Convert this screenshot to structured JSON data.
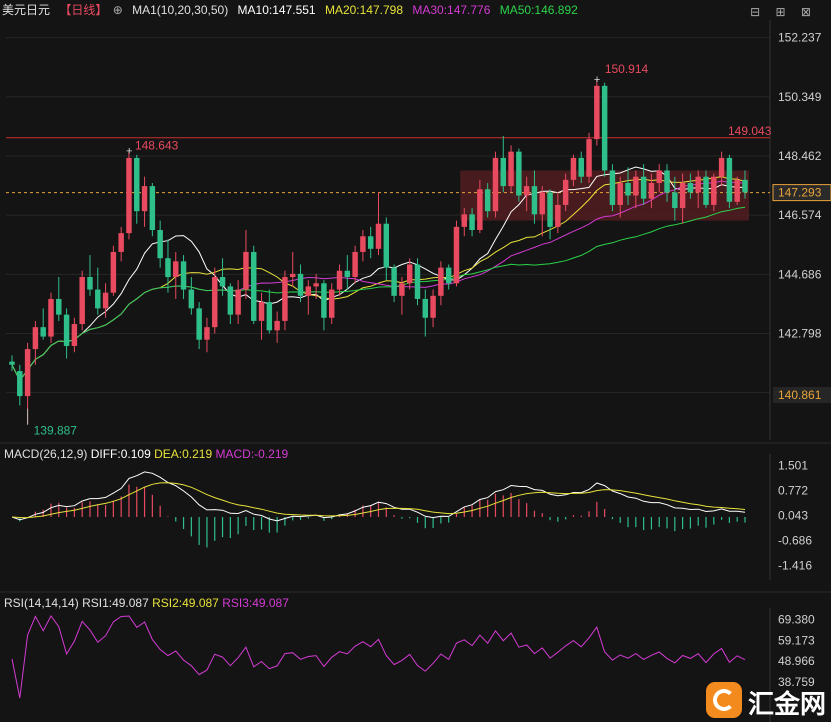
{
  "header": {
    "symbol": "美元日元",
    "period": "【日线】",
    "ma_title": "MA1(10,20,30,50)",
    "ma10": "MA10:147.551",
    "ma20": "MA20:147.798",
    "ma30": "MA30:147.776",
    "ma50": "MA50:146.892",
    "icons": "⊟ ⊞ ⊠"
  },
  "macd_header": {
    "title": "MACD(26,12,9)",
    "diff": "DIFF:0.109",
    "dea": "DEA:0.219",
    "macd": "MACD:-0.219"
  },
  "rsi_header": {
    "title": "RSI(14,14,14)",
    "rsi1": "RSI1:49.087",
    "rsi2": "RSI2:49.087",
    "rsi3": "RSI3:49.087"
  },
  "colors": {
    "up": "#e84a5f",
    "down": "#2fbf8a",
    "ma10": "#ffffff",
    "ma20": "#e8e23a",
    "ma30": "#d43bd4",
    "ma50": "#2bd44a",
    "bg": "#141414"
  },
  "chart_data": [
    {
      "type": "candlestick",
      "axis_ticks": [
        "152.237",
        "150.349",
        "148.462",
        "146.574",
        "144.686",
        "142.798",
        "140.910"
      ],
      "ylim": [
        139.4,
        152.8
      ],
      "annotations": {
        "high_label": "150.914",
        "high_value": 150.914,
        "mid_high_label": "148.643",
        "mid_high_value": 148.643,
        "low_label": "139.887",
        "low_value": 139.887,
        "resistance_label": "149.043",
        "resistance_value": 149.043,
        "current_label": "147.293",
        "current_value": 147.293,
        "min_label": "140.861"
      },
      "candles": [
        [
          141.9,
          142.1,
          141.6,
          141.8
        ],
        [
          141.6,
          141.8,
          140.5,
          140.8
        ],
        [
          140.8,
          142.5,
          139.9,
          142.3
        ],
        [
          142.3,
          143.2,
          141.8,
          143.0
        ],
        [
          143.0,
          143.6,
          142.6,
          142.7
        ],
        [
          142.7,
          144.1,
          142.5,
          143.9
        ],
        [
          143.9,
          144.6,
          143.2,
          143.4
        ],
        [
          143.4,
          143.6,
          142.0,
          142.4
        ],
        [
          142.4,
          143.3,
          142.2,
          143.1
        ],
        [
          143.1,
          144.8,
          142.9,
          144.6
        ],
        [
          144.6,
          145.3,
          144.0,
          144.2
        ],
        [
          144.2,
          144.9,
          143.4,
          143.6
        ],
        [
          143.6,
          144.4,
          143.3,
          144.1
        ],
        [
          144.1,
          145.6,
          144.0,
          145.4
        ],
        [
          145.4,
          146.2,
          145.1,
          146.0
        ],
        [
          146.0,
          148.6,
          145.8,
          148.4
        ],
        [
          148.4,
          148.5,
          146.3,
          146.7
        ],
        [
          146.7,
          147.8,
          146.2,
          147.5
        ],
        [
          147.5,
          147.6,
          145.9,
          146.1
        ],
        [
          146.1,
          146.4,
          144.9,
          145.2
        ],
        [
          145.2,
          145.8,
          144.1,
          144.6
        ],
        [
          144.6,
          145.4,
          143.9,
          145.1
        ],
        [
          145.1,
          145.3,
          143.9,
          144.2
        ],
        [
          144.2,
          144.6,
          143.4,
          143.6
        ],
        [
          143.6,
          143.8,
          142.3,
          142.6
        ],
        [
          142.6,
          143.3,
          142.2,
          143.0
        ],
        [
          143.0,
          144.9,
          142.8,
          144.6
        ],
        [
          144.6,
          145.2,
          144.0,
          144.3
        ],
        [
          144.3,
          144.4,
          143.1,
          143.4
        ],
        [
          143.4,
          144.5,
          143.1,
          144.2
        ],
        [
          144.2,
          146.1,
          143.9,
          145.4
        ],
        [
          145.4,
          145.6,
          143.1,
          143.2
        ],
        [
          143.2,
          144.1,
          142.6,
          143.8
        ],
        [
          143.8,
          144.2,
          142.8,
          142.9
        ],
        [
          142.9,
          143.5,
          142.5,
          143.2
        ],
        [
          143.2,
          144.8,
          142.9,
          144.6
        ],
        [
          144.6,
          145.4,
          144.3,
          144.7
        ],
        [
          144.7,
          145.0,
          143.8,
          144.0
        ],
        [
          144.0,
          144.5,
          143.4,
          144.3
        ],
        [
          144.3,
          144.7,
          143.9,
          144.4
        ],
        [
          144.4,
          144.5,
          142.9,
          143.3
        ],
        [
          143.3,
          144.4,
          143.1,
          144.2
        ],
        [
          144.2,
          145.0,
          144.0,
          144.8
        ],
        [
          144.8,
          145.3,
          144.2,
          144.6
        ],
        [
          144.6,
          145.6,
          144.4,
          145.4
        ],
        [
          145.4,
          146.1,
          145.1,
          145.9
        ],
        [
          145.9,
          146.2,
          145.2,
          145.5
        ],
        [
          145.5,
          147.3,
          145.3,
          146.3
        ],
        [
          146.3,
          146.5,
          144.5,
          144.9
        ],
        [
          144.9,
          145.0,
          143.8,
          144.0
        ],
        [
          144.0,
          144.6,
          143.4,
          144.4
        ],
        [
          144.4,
          145.2,
          144.2,
          145.0
        ],
        [
          145.0,
          145.2,
          143.7,
          143.9
        ],
        [
          143.9,
          144.2,
          142.7,
          143.3
        ],
        [
          143.3,
          144.2,
          143.0,
          144.0
        ],
        [
          144.0,
          145.1,
          143.7,
          144.9
        ],
        [
          144.9,
          145.0,
          144.2,
          144.4
        ],
        [
          144.4,
          146.4,
          144.3,
          146.2
        ],
        [
          146.2,
          146.8,
          145.9,
          146.6
        ],
        [
          146.6,
          146.8,
          145.9,
          146.1
        ],
        [
          146.1,
          147.7,
          146.0,
          147.4
        ],
        [
          147.4,
          147.6,
          146.5,
          146.7
        ],
        [
          146.7,
          148.6,
          146.5,
          148.4
        ],
        [
          148.4,
          149.1,
          147.3,
          147.5
        ],
        [
          147.5,
          148.8,
          147.3,
          148.6
        ],
        [
          148.6,
          148.7,
          147.0,
          147.2
        ],
        [
          147.2,
          147.8,
          146.7,
          147.5
        ],
        [
          147.5,
          148.0,
          146.3,
          146.6
        ],
        [
          146.6,
          147.5,
          145.9,
          147.3
        ],
        [
          147.3,
          147.4,
          145.8,
          146.2
        ],
        [
          146.2,
          147.3,
          146.0,
          146.9
        ],
        [
          146.9,
          147.9,
          146.7,
          147.7
        ],
        [
          147.7,
          148.5,
          147.5,
          148.4
        ],
        [
          148.4,
          148.6,
          147.6,
          147.8
        ],
        [
          147.8,
          149.2,
          147.6,
          149.0
        ],
        [
          149.0,
          150.9,
          148.8,
          150.7
        ],
        [
          150.7,
          150.8,
          147.8,
          148.0
        ],
        [
          148.0,
          148.2,
          146.7,
          146.9
        ],
        [
          146.9,
          147.8,
          146.5,
          147.6
        ],
        [
          147.6,
          148.1,
          146.9,
          147.2
        ],
        [
          147.2,
          148.0,
          146.8,
          147.8
        ],
        [
          147.8,
          148.2,
          146.9,
          147.1
        ],
        [
          147.1,
          147.9,
          146.8,
          147.6
        ],
        [
          147.6,
          148.2,
          147.3,
          148.0
        ],
        [
          148.0,
          148.2,
          147.0,
          147.3
        ],
        [
          147.3,
          147.8,
          146.4,
          146.8
        ],
        [
          146.8,
          147.9,
          146.3,
          147.6
        ],
        [
          147.6,
          147.9,
          147.1,
          147.3
        ],
        [
          147.3,
          148.0,
          146.8,
          147.8
        ],
        [
          147.8,
          148.0,
          146.8,
          146.9
        ],
        [
          146.9,
          147.9,
          146.7,
          147.8
        ],
        [
          147.8,
          148.6,
          147.5,
          148.4
        ],
        [
          148.4,
          148.5,
          146.8,
          147.0
        ],
        [
          147.0,
          147.8,
          146.9,
          147.7
        ],
        [
          147.7,
          148.0,
          147.1,
          147.3
        ]
      ]
    },
    {
      "type": "macd",
      "axis_ticks": [
        "1.501",
        "0.772",
        "0.043",
        "-0.686",
        "-1.416"
      ],
      "ylim": [
        -1.6,
        1.6
      ]
    },
    {
      "type": "rsi",
      "axis_ticks": [
        "69.380",
        "59.173",
        "48.966",
        "38.759"
      ],
      "ylim": [
        30,
        72
      ]
    }
  ],
  "brand": {
    "logo_text": "汇金网"
  }
}
